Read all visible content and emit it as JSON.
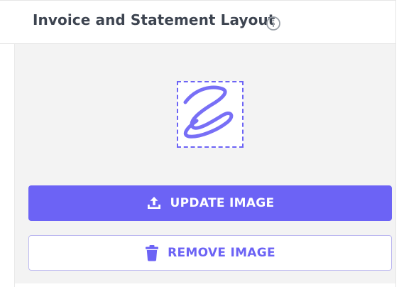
{
  "header": {
    "title": "Invoice and Statement Layout",
    "info_icon": "info-circle-icon"
  },
  "preview": {
    "image": "signature-scribble-image",
    "border_color": "#6c63f5"
  },
  "actions": {
    "update_label": "UPDATE IMAGE",
    "update_icon": "upload-icon",
    "remove_label": "REMOVE IMAGE",
    "remove_icon": "trash-icon"
  },
  "colors": {
    "accent": "#6c63f5",
    "panel_bg": "#f3f3f3",
    "title_text": "#3d4450"
  }
}
